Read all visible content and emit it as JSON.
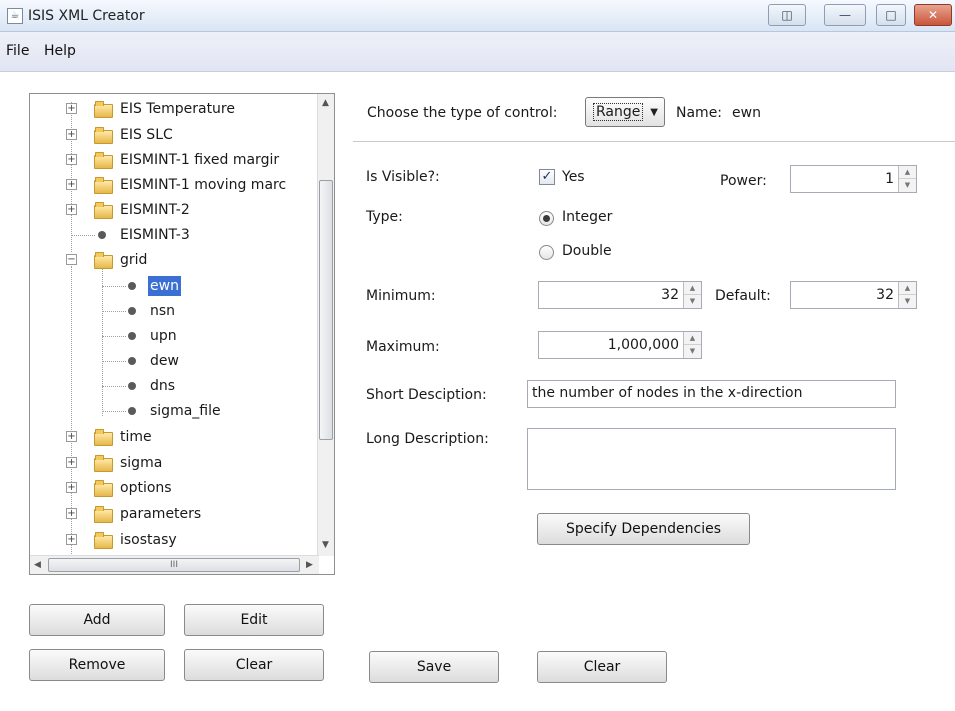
{
  "window": {
    "title": "ISIS XML Creator",
    "icon": "java-cup-icon",
    "controls": [
      "restore-icon",
      "minimize-icon",
      "maximize-icon",
      "close-icon"
    ]
  },
  "menu": {
    "items": [
      "File",
      "Help"
    ]
  },
  "tree": {
    "items": [
      {
        "label": "EIS Temperature",
        "type": "folder"
      },
      {
        "label": "EIS SLC",
        "type": "folder"
      },
      {
        "label": "EISMINT-1 fixed margir",
        "type": "folder"
      },
      {
        "label": "EISMINT-1 moving marc",
        "type": "folder"
      },
      {
        "label": "EISMINT-2",
        "type": "folder"
      },
      {
        "label": "EISMINT-3",
        "type": "leaf"
      },
      {
        "label": "grid",
        "type": "folder",
        "expanded": true
      },
      {
        "label": "ewn",
        "type": "leaf",
        "selected": true
      },
      {
        "label": "nsn",
        "type": "leaf"
      },
      {
        "label": "upn",
        "type": "leaf"
      },
      {
        "label": "dew",
        "type": "leaf"
      },
      {
        "label": "dns",
        "type": "leaf"
      },
      {
        "label": "sigma_file",
        "type": "leaf"
      },
      {
        "label": "time",
        "type": "folder"
      },
      {
        "label": "sigma",
        "type": "folder"
      },
      {
        "label": "options",
        "type": "folder"
      },
      {
        "label": "parameters",
        "type": "folder"
      },
      {
        "label": "isostasy",
        "type": "folder"
      }
    ],
    "hscroll_grip": "III"
  },
  "tree_buttons": {
    "add": "Add",
    "edit": "Edit",
    "remove": "Remove",
    "clear": "Clear"
  },
  "form": {
    "control_type_label": "Choose the type of control:",
    "control_type_value": "Range",
    "name_label": "Name:",
    "name_value": "ewn",
    "visible_label": "Is Visible?:",
    "visible_option": "Yes",
    "visible_checked": true,
    "power_label": "Power:",
    "power_value": "1",
    "type_label": "Type:",
    "type_options": [
      "Integer",
      "Double"
    ],
    "type_selected": "Integer",
    "minimum_label": "Minimum:",
    "minimum_value": "32",
    "default_label": "Default:",
    "default_value": "32",
    "maximum_label": "Maximum:",
    "maximum_value": "1,000,000",
    "short_desc_label": "Short Desciption:",
    "short_desc_value": "the number of nodes in the x-direction",
    "long_desc_label": "Long Description:",
    "long_desc_value": "",
    "dependencies_button": "Specify Dependencies",
    "save_button": "Save",
    "clear_button": "Clear"
  }
}
